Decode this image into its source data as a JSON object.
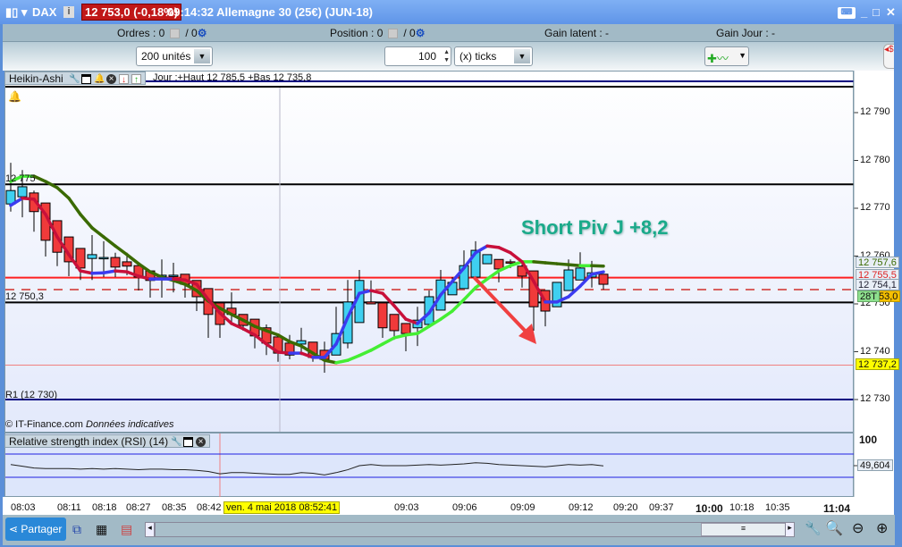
{
  "titlebar": {
    "symbol": "DAX",
    "price_badge": "12 753,0 (-0,18%)",
    "info": "09:14:32 Allemagne 30 (25€) (JUN-18)",
    "icons": [
      "candlestick-icon",
      "info-icon",
      "keyboard-icon",
      "minimize-icon",
      "maximize-icon",
      "close-icon"
    ]
  },
  "status": {
    "orders_label": "Ordres : 0",
    "orders_slash": "/ 0",
    "position_label": "Position : 0",
    "position_slash": "/ 0",
    "gain_latent": "Gain latent :  -",
    "gain_jour": "Gain Jour :  -"
  },
  "toolbar": {
    "units": "200 unités",
    "ticks_value": "100",
    "ticks_unit": "(x) ticks"
  },
  "chart_header": {
    "type": "Heikin-Ashi",
    "day_info": "Jour :+Haut 12 785,5 +Bas 12 735,8"
  },
  "annotations": {
    "line_12775": "12 775",
    "line_12750": "12 750,3",
    "r1": "R1  (12 730)",
    "copyright": "© IT-Finance.com",
    "disclaimer": "Données indicatives",
    "signal": "Short Piv J +8,2"
  },
  "colors": {
    "signal": "#1aaa8a",
    "bull": "#3fd0f0",
    "bear": "#f03a3a",
    "ma_up": "#3b3bf0",
    "ma_down": "#c8103a",
    "slow_up": "#44ee33",
    "slow_down": "#3a6a00"
  },
  "price_axis": {
    "ticks": [
      "12 790",
      "12 780",
      "12 770",
      "12 760",
      "12 750",
      "12 740",
      "12 730"
    ],
    "labels": {
      "slow_ma": "12 757,6",
      "red_line": "12 755,5",
      "fast_ma": "12 754,1",
      "ticks_badge": "28T",
      "last": "53,0",
      "pink": "12 737,2"
    }
  },
  "rsi": {
    "title": "Relative strength index (RSI) (14)",
    "top_label": "100",
    "value": "49,604"
  },
  "time_axis": {
    "labels": [
      "08:03",
      "08:11",
      "08:18",
      "08:27",
      "08:35",
      "08:42",
      "09:03",
      "09:06",
      "09:09",
      "09:12",
      "09:20",
      "09:37",
      "10:00",
      "10:18",
      "10:35",
      "11:04"
    ],
    "cursor_date": "ven. 4 mai 2018 08:52:41"
  },
  "bottom": {
    "share": "Partager"
  },
  "chart_data": {
    "type": "candlestick",
    "subtype": "heikin-ashi",
    "ylim": [
      12728,
      12797
    ],
    "price_ticks": [
      12790,
      12780,
      12770,
      12760,
      12750,
      12740,
      12730
    ],
    "hlines": {
      "black_1": 12775,
      "black_2": 12750.3,
      "red": 12755.5,
      "last_dashed": 12753.0,
      "pink": 12737.2,
      "r1": 12730
    },
    "candles": [
      [
        12770.9,
        12779.5,
        12769.3,
        12773.7
      ],
      [
        12772.4,
        12778.0,
        12768.1,
        12774.5
      ],
      [
        12773.2,
        12773.7,
        12765.1,
        12769.3
      ],
      [
        12771.1,
        12771.1,
        12759.9,
        12763.3
      ],
      [
        12767.4,
        12767.4,
        12757.9,
        12760.8
      ],
      [
        12764.0,
        12764.0,
        12755.8,
        12758.8
      ],
      [
        12761.6,
        12761.6,
        12755.0,
        12757.5
      ],
      [
        12759.5,
        12764.4,
        12755.0,
        12760.3
      ],
      [
        12759.7,
        12763.1,
        12755.6,
        12759.7
      ],
      [
        12759.7,
        12760.7,
        12755.6,
        12757.7
      ],
      [
        12758.8,
        12760.7,
        12756.0,
        12757.9
      ],
      [
        12758.0,
        12758.0,
        12752.8,
        12755.6
      ],
      [
        12756.9,
        12756.9,
        12751.3,
        12754.9
      ],
      [
        12756.0,
        12759.3,
        12751.3,
        12756.0
      ],
      [
        12756.0,
        12758.6,
        12752.4,
        12756.0
      ],
      [
        12756.2,
        12756.2,
        12751.3,
        12754.1
      ],
      [
        12754.9,
        12754.9,
        12748.5,
        12751.5
      ],
      [
        12753.2,
        12753.2,
        12742.9,
        12747.8
      ],
      [
        12750.2,
        12750.2,
        12742.9,
        12745.7
      ],
      [
        12749.1,
        12752.4,
        12745.7,
        12747.8
      ],
      [
        12747.8,
        12747.8,
        12744.4,
        12745.5
      ],
      [
        12746.8,
        12746.8,
        12740.7,
        12743.3
      ],
      [
        12745.0,
        12745.7,
        12739.3,
        12741.8
      ],
      [
        12743.1,
        12743.1,
        12737.9,
        12739.7
      ],
      [
        12741.8,
        12743.5,
        12738.4,
        12739.3
      ],
      [
        12741.6,
        12745.0,
        12739.3,
        12742.3
      ],
      [
        12742.0,
        12742.0,
        12737.9,
        12738.8
      ],
      [
        12740.3,
        12742.1,
        12735.6,
        12738.4
      ],
      [
        12739.3,
        12749.4,
        12739.3,
        12743.8
      ],
      [
        12741.8,
        12755.0,
        12740.7,
        12750.4
      ],
      [
        12746.1,
        12757.1,
        12746.1,
        12754.9
      ],
      [
        12750.4,
        12754.9,
        12750.0,
        12750.0
      ],
      [
        12750.2,
        12750.2,
        12742.9,
        12745.0
      ],
      [
        12747.8,
        12747.8,
        12742.5,
        12744.4
      ],
      [
        12745.9,
        12745.9,
        12740.1,
        12743.8
      ],
      [
        12745.0,
        12749.4,
        12741.2,
        12746.6
      ],
      [
        12745.7,
        12752.8,
        12745.7,
        12751.5
      ],
      [
        12748.7,
        12757.1,
        12748.7,
        12755.0
      ],
      [
        12751.9,
        12755.6,
        12751.9,
        12754.5
      ],
      [
        12753.2,
        12761.2,
        12753.2,
        12758.0
      ],
      [
        12755.6,
        12763.1,
        12755.6,
        12761.2
      ],
      [
        12758.4,
        12760.3,
        12758.4,
        12760.3
      ],
      [
        12759.3,
        12759.3,
        12754.5,
        12757.3
      ],
      [
        12758.8,
        12759.3,
        12757.5,
        12758.7
      ],
      [
        12757.9,
        12758.8,
        12753.4,
        12755.8
      ],
      [
        12756.9,
        12756.9,
        12744.4,
        12749.4
      ],
      [
        12752.8,
        12752.8,
        12745.3,
        12748.5
      ],
      [
        12749.4,
        12754.5,
        12749.4,
        12754.5
      ],
      [
        12752.8,
        12759.3,
        12752.8,
        12757.1
      ],
      [
        12755.0,
        12760.8,
        12755.0,
        12757.5
      ],
      [
        12755.6,
        12759.0,
        12753.4,
        12756.5
      ],
      [
        12756.2,
        12756.2,
        12753.0,
        12754.1
      ]
    ],
    "fast_ma": [
      12770.6,
      12772.1,
      12771.9,
      12768.7,
      12764.0,
      12760.3,
      12756.9,
      12756.4,
      12756.5,
      12756.9,
      12756.7,
      12755.8,
      12755.2,
      12755.2,
      12755.2,
      12755.0,
      12754.1,
      12750.9,
      12748.1,
      12745.9,
      12744.8,
      12743.5,
      12741.6,
      12739.9,
      12739.7,
      12739.7,
      12738.8,
      12738.8,
      12741.6,
      12747.2,
      12752.2,
      12752.8,
      12752.2,
      12749.6,
      12746.8,
      12745.9,
      12748.1,
      12751.9,
      12754.7,
      12757.5,
      12760.7,
      12762.1,
      12761.8,
      12760.7,
      12758.8,
      12754.7,
      12750.4,
      12750.4,
      12751.5,
      12753.7,
      12756.2,
      12756.7
    ],
    "slow_ma": [
      12775.6,
      12776.7,
      12776.7,
      12775.6,
      12774.3,
      12772.1,
      12768.7,
      12765.9,
      12764.0,
      12762.1,
      12760.3,
      12758.4,
      12756.7,
      12755.6,
      12754.9,
      12754.1,
      12752.8,
      12750.6,
      12749.1,
      12747.8,
      12746.6,
      12745.3,
      12744.4,
      12743.5,
      12742.1,
      12741.2,
      12739.7,
      12738.2,
      12737.7,
      12738.2,
      12739.2,
      12740.3,
      12741.6,
      12742.9,
      12743.5,
      12743.8,
      12745.3,
      12746.8,
      12748.5,
      12750.9,
      12753.4,
      12755.2,
      12756.9,
      12758.0,
      12758.8,
      12758.8,
      12758.6,
      12758.4,
      12758.2,
      12758.0,
      12758.0,
      12757.9
    ],
    "rsi": [
      52,
      49,
      46,
      45,
      45,
      45,
      44,
      45,
      44,
      45,
      44,
      43,
      44,
      44,
      43,
      43,
      42,
      40,
      36,
      38,
      38,
      37,
      36,
      35,
      35,
      38,
      37,
      34,
      38,
      43,
      50,
      52,
      50,
      50,
      50,
      51,
      52,
      51,
      52,
      53,
      55,
      54,
      52,
      51,
      50,
      49,
      48,
      50,
      52,
      51,
      52,
      49.6
    ],
    "rsi_levels": [
      70,
      30
    ]
  }
}
